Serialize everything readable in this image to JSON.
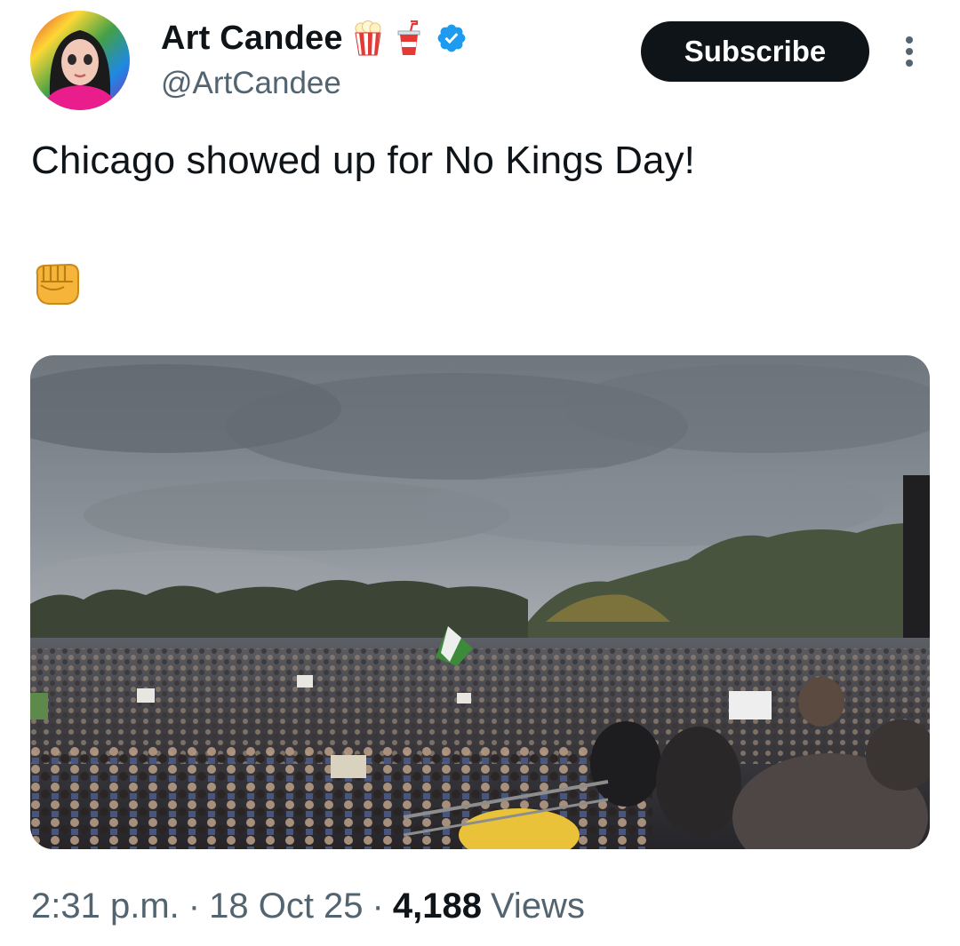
{
  "author": {
    "display_name": "Art Candee",
    "handle": "@ArtCandee",
    "badges": [
      "popcorn-icon",
      "soda-cup-icon",
      "verified-badge-icon"
    ]
  },
  "actions": {
    "subscribe_label": "Subscribe",
    "more_icon": "more-vertical-icon"
  },
  "tweet": {
    "text": "Chicago showed up for No Kings Day!",
    "emoji": "fist-icon"
  },
  "media": {
    "type": "video",
    "depicts": "crowd-photo"
  },
  "meta": {
    "time": "2:31 p.m.",
    "separator": "·",
    "date": "18 Oct 25",
    "views_count": "4,188",
    "views_label": "Views"
  },
  "colors": {
    "text_primary": "#0f1419",
    "text_secondary": "#536471",
    "verified_blue": "#1d9bf0",
    "button_bg": "#0f1419"
  }
}
